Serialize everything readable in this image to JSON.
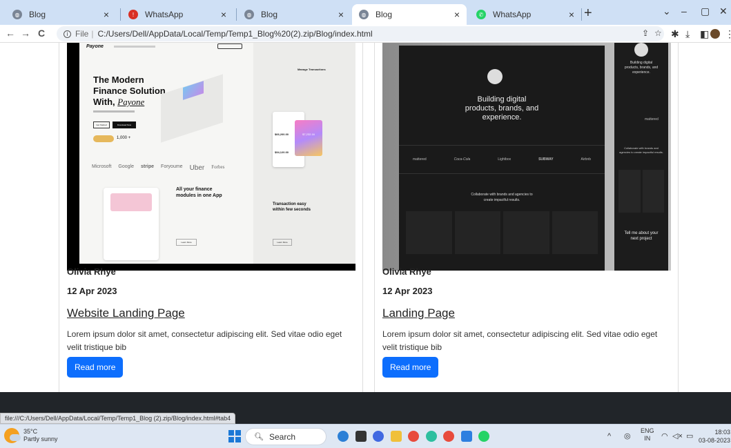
{
  "browser": {
    "tabs": [
      {
        "title": "Blog",
        "icon": "globe-icon",
        "active": false
      },
      {
        "title": "WhatsApp",
        "icon": "whatsapp-error-icon",
        "active": false
      },
      {
        "title": "Blog",
        "icon": "globe-icon",
        "active": false
      },
      {
        "title": "Blog",
        "icon": "globe-icon",
        "active": true
      },
      {
        "title": "WhatsApp",
        "icon": "whatsapp-icon",
        "active": false
      }
    ],
    "close_glyph": "×",
    "new_tab_glyph": "+",
    "window_controls": {
      "dropdown": "⌄",
      "minimize": "–",
      "restore": "▢",
      "close": "✕"
    },
    "nav": {
      "back": "←",
      "forward": "→",
      "reload": "C"
    },
    "address": {
      "scheme": "File",
      "url": "C:/Users/Dell/AppData/Local/Temp/Temp1_Blog%20(2).zip/Blog/index.html"
    },
    "status_url": "file:///C:/Users/Dell/AppData/Local/Temp/Temp1_Blog (2).zip/Blog/index.html#tab4"
  },
  "posts": [
    {
      "image_texts": {
        "logo": "Payone",
        "headline_1": "The Modern",
        "headline_2": "Finance Solution",
        "headline_3": "With,",
        "headline_brand": "Payone",
        "get_started": "Get Started",
        "download": "Download Now",
        "stat": "1,000 +",
        "manage": "Manage Transactions",
        "amount_1": "$66,200.00",
        "amount_2": "$94,120.00",
        "card_amount": "$7,232.16",
        "brands": [
          "Microsoft",
          "Google",
          "stripe",
          "Foryoume",
          "Uber",
          "Forbes"
        ],
        "modules_1": "All your finance",
        "modules_2": "modules in one App",
        "easy_1": "Transaction easy",
        "easy_2": "within few seconds",
        "learn": "Learn More"
      },
      "author": "Olivia Rhye",
      "date": "12 Apr 2023",
      "title": "Website Landing Page",
      "excerpt": "Lorem ipsum dolor sit amet, consectetur adipiscing elit. Sed vitae odio eget velit tristique bib",
      "button": "Read more"
    },
    {
      "image_texts": {
        "hero_1": "Building digital",
        "hero_2": "products, brands, and",
        "hero_3": "experience.",
        "side_1": "Building digital",
        "side_2": "products, brands, and",
        "side_3": "experience.",
        "logos": [
          "mattered",
          "Coca-Cola",
          "Lightbox",
          "SUBWAY",
          "Airbnb"
        ],
        "collab_1": "Collaborate with brands and agencies to",
        "collab_2": "create impactful results.",
        "side_collab": "Collaborate with brands and agencies to create impactful results.",
        "side_logo": "mattered",
        "tell_1": "Tell me about your",
        "tell_2": "next project"
      },
      "author": "Olivia Rhye",
      "date": "12 Apr 2023",
      "title": "Landing Page",
      "excerpt": "Lorem ipsum dolor sit amet, consectetur adipiscing elit. Sed vitae odio eget velit tristique bib",
      "button": "Read more"
    }
  ],
  "taskbar": {
    "weather_temp": "35°C",
    "weather_desc": "Partly sunny",
    "search": "Search",
    "lang": "ENG",
    "region": "IN",
    "time": "18:03",
    "date": "03-08-2023"
  },
  "colors": {
    "accent": "#0d6efd",
    "tabbar": "#cfe0f5",
    "dark_band": "#212529"
  }
}
